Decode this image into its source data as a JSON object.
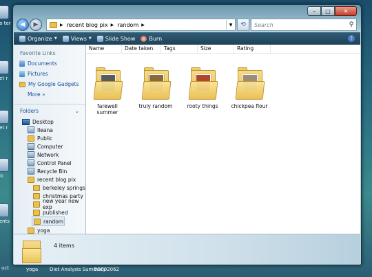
{
  "window": {
    "caption_buttons": [
      "minimize",
      "maximize",
      "close"
    ]
  },
  "address": {
    "segments": [
      "recent blog pix",
      "random"
    ]
  },
  "search": {
    "placeholder": "Search"
  },
  "toolbar": {
    "items": [
      "Organize",
      "Views",
      "Slide Show",
      "Burn"
    ]
  },
  "nav": {
    "favorite_links_title": "Favorite Links",
    "favorites": [
      "Documents",
      "Pictures",
      "My Google Gadgets"
    ],
    "more_label": "More",
    "more_glyph": "»",
    "folders_title": "Folders",
    "folders_glyph": "⌄",
    "tree": [
      {
        "label": "Desktop",
        "type": "desktop"
      },
      {
        "label": "Ileana",
        "type": "user"
      },
      {
        "label": "Public",
        "type": "folder"
      },
      {
        "label": "Computer",
        "type": "computer"
      },
      {
        "label": "Network",
        "type": "network"
      },
      {
        "label": "Control Panel",
        "type": "control"
      },
      {
        "label": "Recycle Bin",
        "type": "recycle"
      },
      {
        "label": "recent blog pix",
        "type": "folder"
      },
      {
        "label": "berkeley springs",
        "type": "folder"
      },
      {
        "label": "christmas party",
        "type": "folder"
      },
      {
        "label": "new year new exp",
        "type": "folder"
      },
      {
        "label": "published",
        "type": "folder"
      },
      {
        "label": "random",
        "type": "folder",
        "selected": true
      },
      {
        "label": "yoga",
        "type": "folder"
      }
    ]
  },
  "columns": [
    "Name",
    "Date taken",
    "Tags",
    "Size",
    "Rating"
  ],
  "items": [
    {
      "name": "farewell summer",
      "photo_color": "#5b5b5b"
    },
    {
      "name": "truly random",
      "photo_color": "#8a6a3a"
    },
    {
      "name": "rooty things",
      "photo_color": "#b1462f"
    },
    {
      "name": "chickpea flour",
      "photo_color": "#9a8e7a"
    }
  ],
  "details": {
    "count_text": "4 items"
  },
  "desktop": {
    "left_labels": [
      "ppo\nter",
      "net\nr",
      "net\nr",
      "ic",
      "ments"
    ],
    "bottom_labels": [
      "uct",
      "yoga",
      "Diet Analysis\nSummary",
      "DSC02062"
    ]
  }
}
